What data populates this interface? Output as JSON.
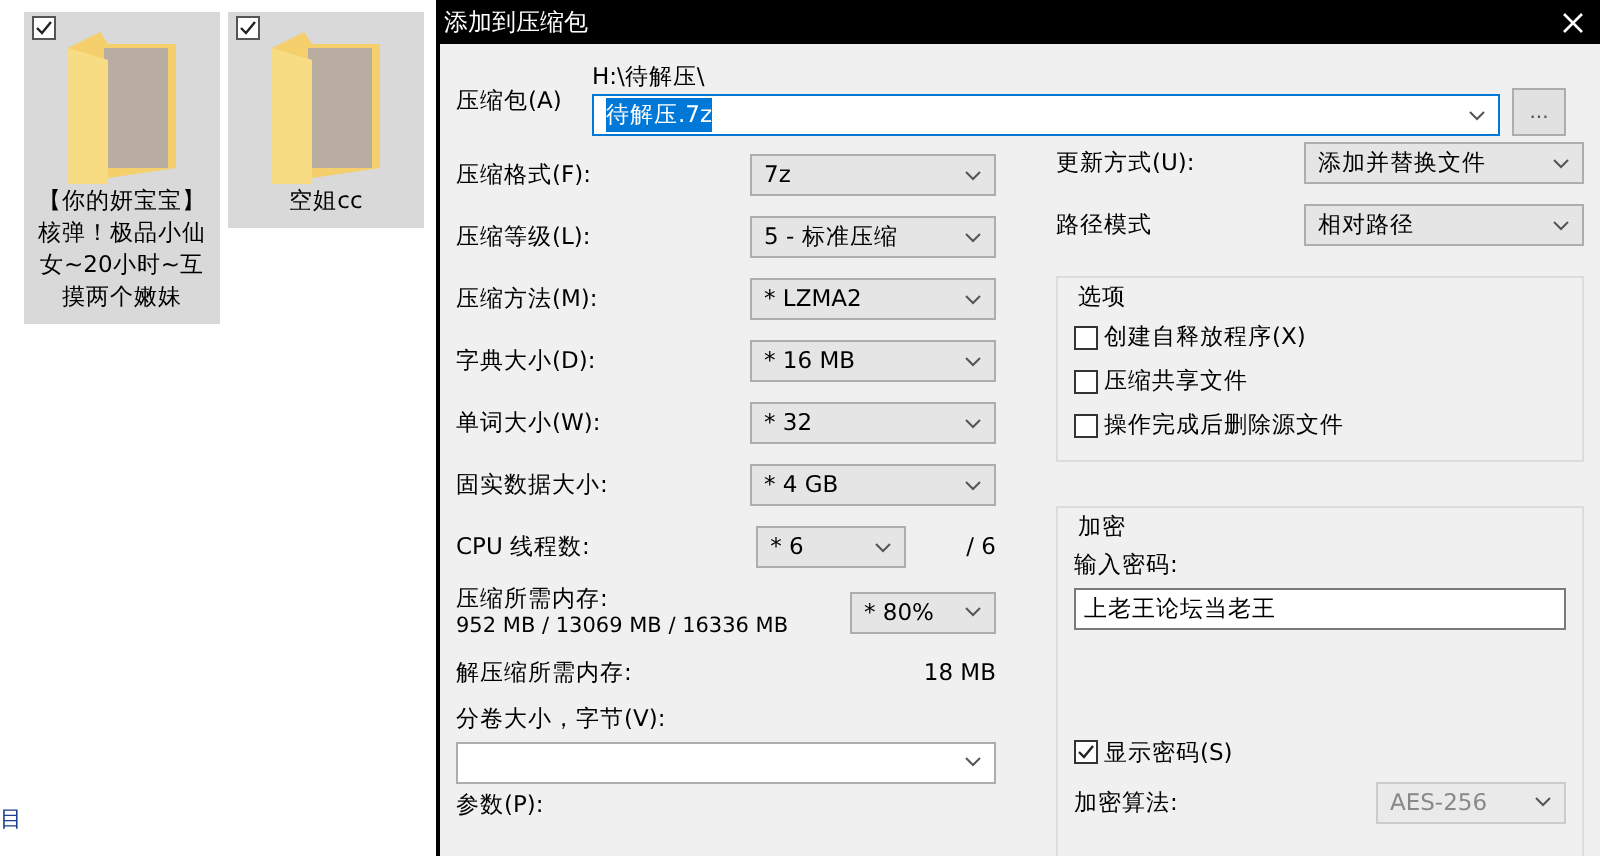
{
  "explorer": {
    "items": [
      {
        "name": "【你的妍宝宝】核弹！极品小仙女~20小时~互摸两个嫩妹",
        "checked": true
      },
      {
        "name": "空姐cc",
        "checked": true
      }
    ],
    "status_text": "目"
  },
  "dialog": {
    "title": "添加到压缩包",
    "archive": {
      "label": "压缩包(A)",
      "folder": "H:\\待解压\\",
      "value": "待解压.7z",
      "browse": "..."
    },
    "left_fields": [
      {
        "kind": "combo",
        "label": "压缩格式(F):",
        "value": "7z"
      },
      {
        "kind": "combo",
        "label": "压缩等级(L):",
        "value": "5 - 标准压缩"
      },
      {
        "kind": "combo",
        "label": "压缩方法(M):",
        "value": "* LZMA2"
      },
      {
        "kind": "combo",
        "label": "字典大小(D):",
        "value": "* 16 MB"
      },
      {
        "kind": "combo",
        "label": "单词大小(W):",
        "value": "* 32"
      },
      {
        "kind": "combo",
        "label": "固实数据大小:",
        "value": "* 4 GB"
      },
      {
        "kind": "threads",
        "label": "CPU 线程数:",
        "value": "* 6",
        "suffix": "/ 6"
      },
      {
        "kind": "memory",
        "label": "压缩所需内存:",
        "detail": "952 MB / 13069 MB / 16336 MB",
        "value": "* 80%"
      },
      {
        "kind": "readout",
        "label": "解压缩所需内存:",
        "value": "18 MB"
      },
      {
        "kind": "volume",
        "label": "分卷大小，字节(V):"
      },
      {
        "kind": "label",
        "label": "参数(P):"
      }
    ],
    "right_fields": [
      {
        "label": "更新方式(U):",
        "value": "添加并替换文件"
      },
      {
        "label": "路径模式",
        "value": "相对路径"
      }
    ],
    "options": {
      "title": "选项",
      "items": [
        {
          "label": "创建自释放程序(X)",
          "checked": false
        },
        {
          "label": "压缩共享文件",
          "checked": false
        },
        {
          "label": "操作完成后删除源文件",
          "checked": false
        }
      ]
    },
    "encryption": {
      "title": "加密",
      "password_label": "输入密码:",
      "password": "上老王论坛当老王",
      "show_password": {
        "label": "显示密码(S)",
        "checked": true
      },
      "method_label": "加密算法:",
      "method": "AES-256",
      "method_disabled": true
    }
  }
}
